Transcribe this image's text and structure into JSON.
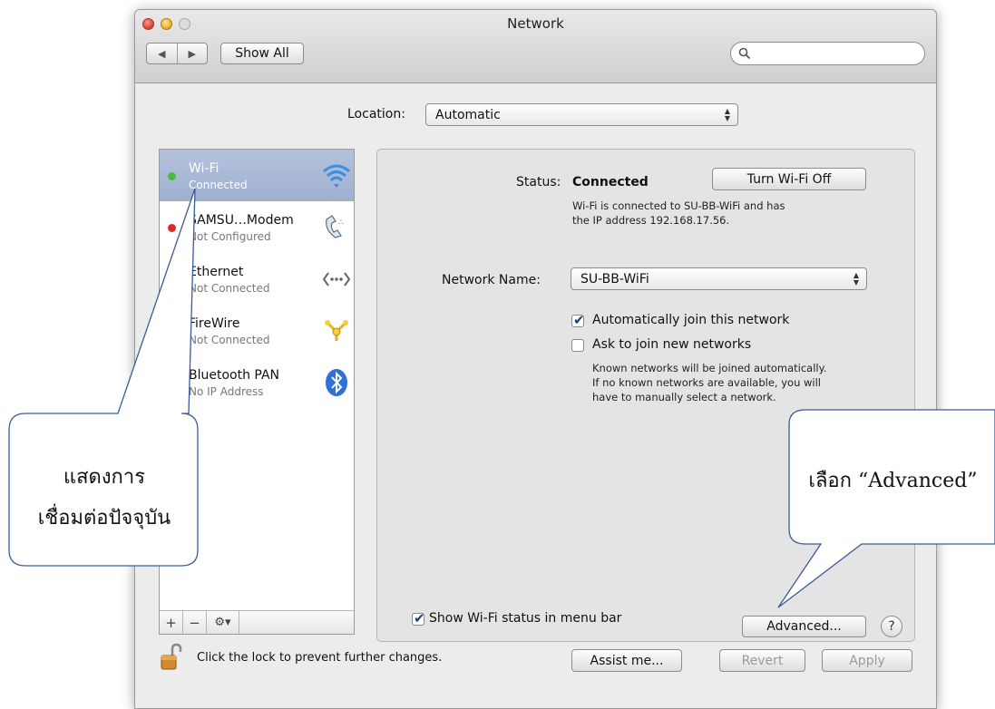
{
  "window": {
    "title": "Network"
  },
  "toolbar": {
    "show_all_label": "Show All",
    "search_placeholder": ""
  },
  "location": {
    "label": "Location:",
    "value": "Automatic"
  },
  "services": [
    {
      "name": "Wi-Fi",
      "status": "Connected",
      "dot": "#4cbb3d",
      "icon": "wifi-icon",
      "selected": true
    },
    {
      "name": "SAMSU…Modem",
      "status": "Not Configured",
      "dot": "#dd2a2a",
      "icon": "modem-icon"
    },
    {
      "name": "Ethernet",
      "status": "Not Connected",
      "dot": "#dd2a2a",
      "icon": "ethernet-icon"
    },
    {
      "name": "FireWire",
      "status": "Not Connected",
      "dot": "#dd2a2a",
      "icon": "firewire-icon"
    },
    {
      "name": "Bluetooth PAN",
      "status": "No IP Address",
      "dot": "#e8a42a",
      "icon": "bluetooth-icon"
    }
  ],
  "sidebar_toolbar": {
    "add": "+",
    "remove": "−",
    "gear": "⚙▾"
  },
  "detail": {
    "status_label": "Status:",
    "status_value": "Connected",
    "turn_off_button": "Turn Wi-Fi Off",
    "status_desc_1": "Wi-Fi is connected to SU-BB-WiFi and has",
    "status_desc_2": "the IP address 192.168.17.56.",
    "network_name_label": "Network Name:",
    "network_name_value": "SU-BB-WiFi",
    "auto_join_label": "Automatically join this network",
    "auto_join_checked": true,
    "ask_join_label": "Ask to join new networks",
    "ask_join_checked": false,
    "known_desc_1": "Known networks will be joined automatically.",
    "known_desc_2": "If no known networks are available, you will",
    "known_desc_3": "have to manually select a network.",
    "show_status_label": "Show Wi-Fi status in menu bar",
    "show_status_checked": true,
    "advanced_button": "Advanced...",
    "help_button": "?"
  },
  "footer": {
    "lock_text": "Click the lock to prevent further changes.",
    "assist_button": "Assist me...",
    "revert_button": "Revert",
    "apply_button": "Apply"
  },
  "annotations": {
    "left_callout_line1": "แสดงการ",
    "left_callout_line2": "เชื่อมต่อปัจจุบัน",
    "right_callout": "เลือก “Advanced”"
  },
  "colors": {
    "selection": "#a9b8d4",
    "callout_stroke": "#3a5a9a"
  }
}
